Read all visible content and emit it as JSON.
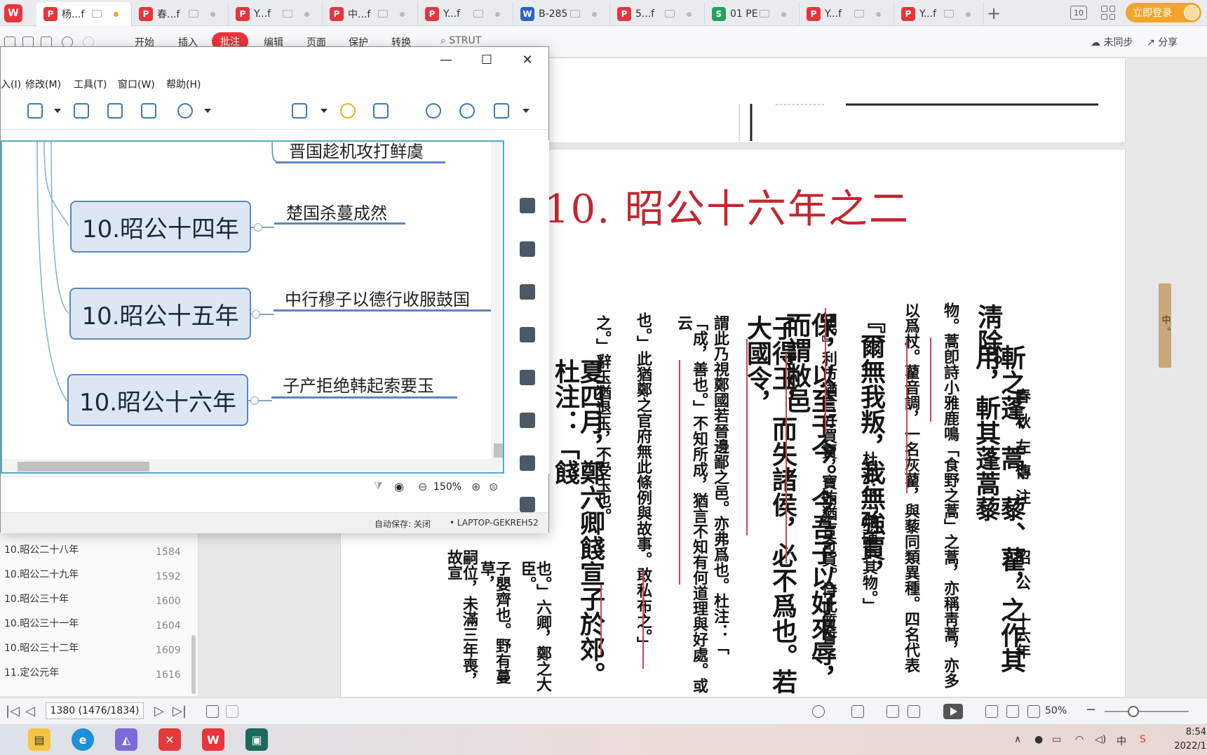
{
  "tabbar": {
    "app_logo": "W",
    "tabs": [
      {
        "label": "杨...f",
        "icon": "pdf-icon",
        "color": "#e8343b",
        "active": true
      },
      {
        "label": "春...f",
        "icon": "pdf-icon",
        "color": "#e8343b"
      },
      {
        "label": "Y...f",
        "icon": "pdf-icon",
        "color": "#e8343b"
      },
      {
        "label": "中...f",
        "icon": "pdf-icon",
        "color": "#e8343b"
      },
      {
        "label": "Y...f",
        "icon": "pdf-icon",
        "color": "#e8343b"
      },
      {
        "label": "B-285",
        "icon": "word-icon",
        "color": "#2b63c7"
      },
      {
        "label": "5...f",
        "icon": "pdf-icon",
        "color": "#e8343b"
      },
      {
        "label": "01 PE",
        "icon": "sheet-icon",
        "color": "#21a35a"
      },
      {
        "label": "Y...f",
        "icon": "pdf-icon",
        "color": "#e8343b"
      },
      {
        "label": "Y...f",
        "icon": "pdf-icon",
        "color": "#e8343b"
      }
    ],
    "add_label": "+",
    "workspace_label": "10",
    "login_label": "立即登录"
  },
  "ribbon": {
    "tabs": [
      "开始",
      "插入",
      "编辑",
      "页面",
      "保护",
      "转换"
    ],
    "active_tab": "批注",
    "search": "STRUT",
    "sync": "未同步",
    "share": "分享"
  },
  "mindmap": {
    "menus": [
      "入(I)",
      "修改(M)",
      "工具(T)",
      "窗口(W)",
      "帮助(H)"
    ],
    "top_partial_label": "晋国趁机攻打鲜虞",
    "nodes": [
      {
        "title": "10.昭公十四年",
        "sub": "楚国杀蔓成然"
      },
      {
        "title": "10.昭公十五年",
        "sub": "中行穆子以德行收服鼓国"
      },
      {
        "title": "10.昭公十六年",
        "sub": "子产拒绝韩起索要玉"
      }
    ],
    "zoom": "150%",
    "autosave": "自动保存: 关闭",
    "host": "LAPTOP-GEKREH52"
  },
  "document": {
    "title": "10. 昭公十六年之二",
    "side_stamp": "中 。",
    "header_cols": [
      "春秋左傳注",
      "昭公",
      "十六年"
    ],
    "columns": [
      {
        "text": "淸除。",
        "size": "big"
      },
      {
        "text": "斬之蓬、蒿、藜、藋，之作其用，斬其蓬蒿藜",
        "size": "big"
      },
      {
        "text": "物。蒿卽詩小雅鹿鳴「食野之蒿」之蒿，亦稱靑蒿，亦多",
        "size": "small"
      },
      {
        "text": "以爲杖。藋音調，一名灰藋，與藜同類異種。四名代表",
        "size": "small"
      },
      {
        "text": "『爾無我叛，我無強賈，",
        "size": "big"
      },
      {
        "text": "杜注：「無強市其物。」",
        "size": "small"
      },
      {
        "text": "知。』利市猶言好買賣，寶賄猶言奇貨。恃此質誓",
        "size": "small"
      },
      {
        "text": "保，以至于今。今吾子以好來辱，而謂敝邑",
        "size": "big"
      },
      {
        "text": "子得玉，而失諸侯，必不爲也。若大國令，",
        "size": "big"
      },
      {
        "text": "謂此乃視鄭國若晉邊鄙之邑。亦弗爲也。杜注：「",
        "size": "small"
      },
      {
        "text": "「成，善也。」不知所成，猶言不知有何道理與好處。或云",
        "size": "small"
      },
      {
        "text": "也。」此猶鄭之官府無此條例與故事。敢私布之。」",
        "size": "small"
      },
      {
        "text": "之。」辭玉猶退玉，不受玉也。",
        "size": "small"
      },
      {
        "text": "夏四月，鄭六卿餞宣子於郊。杜注：「餞",
        "size": "big"
      },
      {
        "text": "也。」六卿，鄭之大臣。",
        "size": "small"
      },
      {
        "text": "子嬰齊也。野有蔓草，",
        "size": "small"
      },
      {
        "text": "嗣位，未滿三年喪，故宣",
        "size": "small"
      }
    ]
  },
  "outline": {
    "items": [
      {
        "label": "10.昭公二十八年",
        "page": "1584"
      },
      {
        "label": "10.昭公二十九年",
        "page": "1592"
      },
      {
        "label": "10.昭公三十年",
        "page": "1600"
      },
      {
        "label": "10.昭公三十一年",
        "page": "1604"
      },
      {
        "label": "10.昭公三十二年",
        "page": "1609"
      },
      {
        "label": "11.定公元年",
        "page": "1616"
      }
    ]
  },
  "statusbar": {
    "page_indicator": "1380 (1476/1834)",
    "zoom": "50%"
  },
  "taskbar": {
    "time": "8:54",
    "date": "2022/1",
    "ime": "中"
  }
}
